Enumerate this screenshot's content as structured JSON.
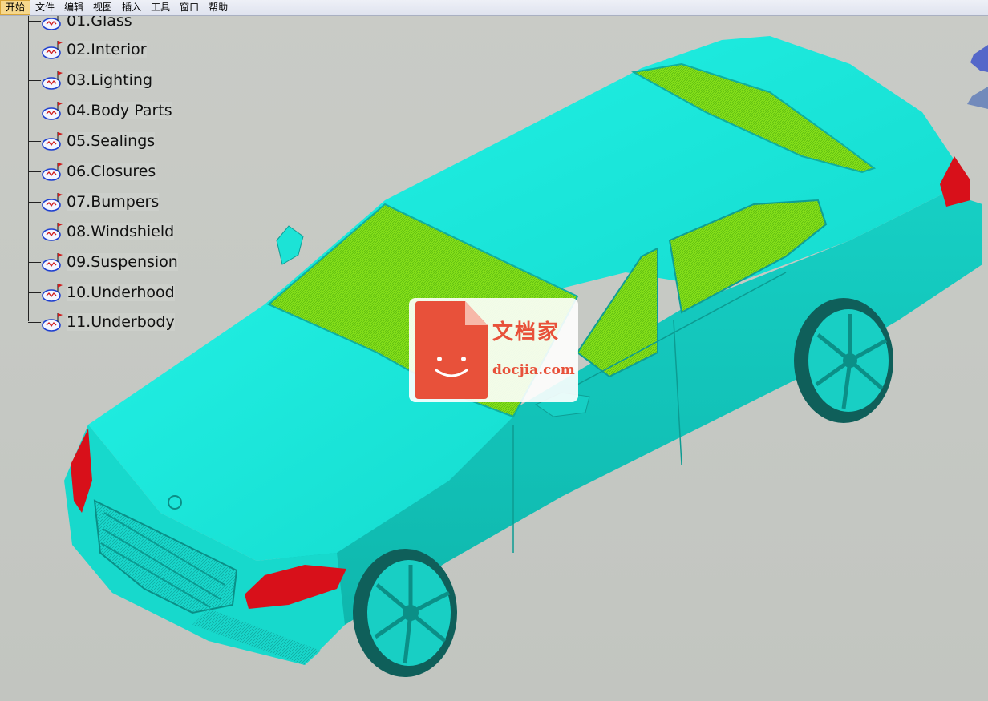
{
  "menubar": {
    "items": [
      "开始",
      "文件",
      "编辑",
      "视图",
      "插入",
      "工具",
      "窗口",
      "帮助"
    ]
  },
  "tree": {
    "items": [
      {
        "label": "01.Glass"
      },
      {
        "label": "02.Interior"
      },
      {
        "label": "03.Lighting"
      },
      {
        "label": "04.Body Parts"
      },
      {
        "label": "05.Sealings"
      },
      {
        "label": "06.Closures"
      },
      {
        "label": "07.Bumpers"
      },
      {
        "label": "08.Windshield"
      },
      {
        "label": "09.Suspension"
      },
      {
        "label": "10.Underhood"
      },
      {
        "label": "11.Underbody"
      }
    ],
    "selected_index": 10
  },
  "watermark": {
    "title": "文档家",
    "url": "docjia.com"
  },
  "colors": {
    "body": "#19e6d8",
    "glass": "#7fe018",
    "lights": "#d8101a",
    "background": "#c8cac5",
    "watermark": "#e8513a"
  }
}
